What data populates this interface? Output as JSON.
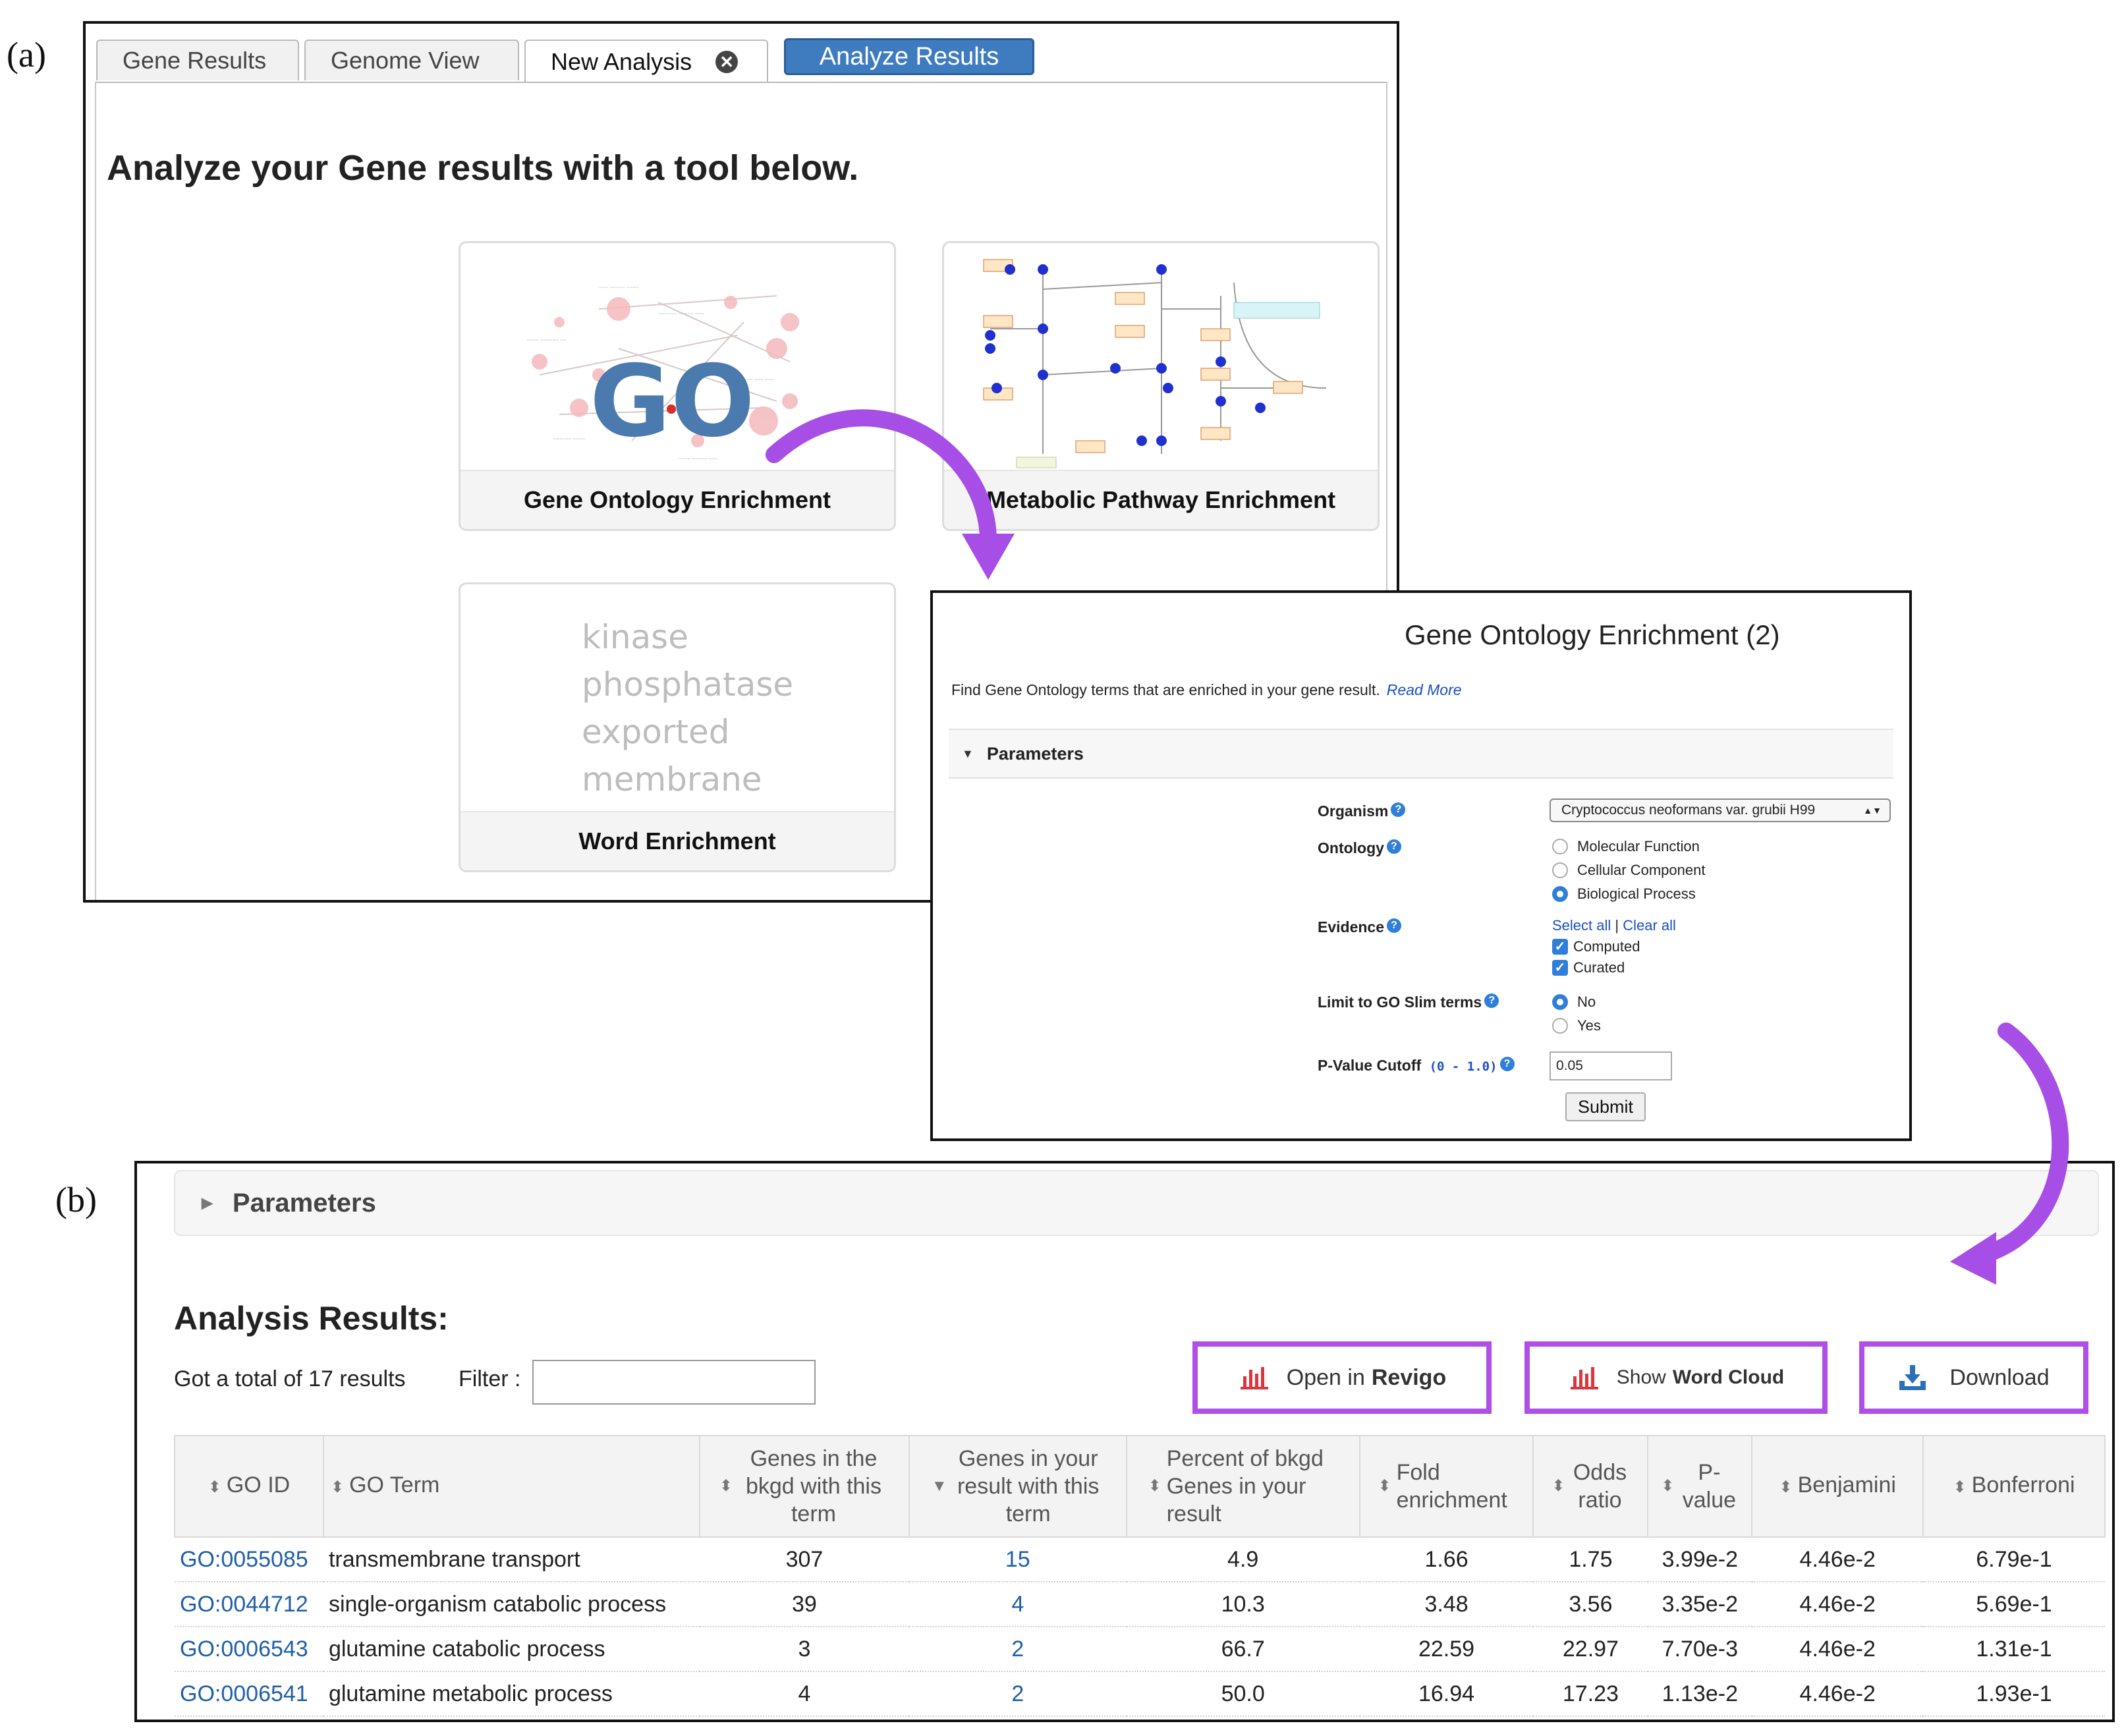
{
  "labels": {
    "a": "(a)",
    "b": "(b)"
  },
  "tabs": [
    {
      "label": "Gene Results",
      "active": false
    },
    {
      "label": "Genome View",
      "active": false
    },
    {
      "label": "New Analysis",
      "active": true
    }
  ],
  "analyze_button": "Analyze Results",
  "analysis_heading": "Analyze your Gene results with a tool below.",
  "tools": {
    "go": {
      "caption": "Gene Ontology Enrichment",
      "logo": "GO"
    },
    "pathway": {
      "caption": "Metabolic Pathway Enrichment"
    },
    "word": {
      "caption": "Word Enrichment",
      "words": [
        "kinase",
        "phosphatase",
        "exported",
        "membrane"
      ]
    }
  },
  "dialog": {
    "title": "Gene Ontology Enrichment (2)",
    "description": "Find Gene Ontology terms that are enriched in your gene result.",
    "read_more": "Read More",
    "parameters_label": "Parameters",
    "organism_label": "Organism",
    "organism_value": "Cryptococcus neoformans var. grubii H99",
    "ontology_label": "Ontology",
    "ontology_options": [
      "Molecular Function",
      "Cellular Component",
      "Biological Process"
    ],
    "ontology_selected": "Biological Process",
    "evidence_label": "Evidence",
    "select_all": "Select all",
    "clear_all": "Clear all",
    "evidence_options": [
      "Computed",
      "Curated"
    ],
    "slim_label": "Limit to GO Slim terms",
    "slim_options": [
      "No",
      "Yes"
    ],
    "slim_selected": "No",
    "pvalue_label": "P-Value Cutoff",
    "pvalue_range": "(0 - 1.0)",
    "pvalue_value": "0.05",
    "submit": "Submit"
  },
  "results": {
    "parameters_label": "Parameters",
    "heading": "Analysis Results:",
    "total": "Got a total of 17 results",
    "filter_label": "Filter :",
    "buttons": {
      "revigo_pre": "Open in",
      "revigo_bold": "Revigo",
      "wordcloud_pre": "Show",
      "wordcloud_bold": "Word Cloud",
      "download": "Download"
    },
    "columns": [
      "GO ID",
      "GO Term",
      "Genes in the bkgd with this term",
      "Genes in your result with this term",
      "Percent of bkgd Genes in your result",
      "Fold enrichment",
      "Odds ratio",
      "P-value",
      "Benjamini",
      "Bonferroni"
    ],
    "rows": [
      [
        "GO:0055085",
        "transmembrane transport",
        "307",
        "15",
        "4.9",
        "1.66",
        "1.75",
        "3.99e-2",
        "4.46e-2",
        "6.79e-1"
      ],
      [
        "GO:0044712",
        "single-organism catabolic process",
        "39",
        "4",
        "10.3",
        "3.48",
        "3.56",
        "3.35e-2",
        "4.46e-2",
        "5.69e-1"
      ],
      [
        "GO:0006543",
        "glutamine catabolic process",
        "3",
        "2",
        "66.7",
        "22.59",
        "22.97",
        "7.70e-3",
        "4.46e-2",
        "1.31e-1"
      ],
      [
        "GO:0006541",
        "glutamine metabolic process",
        "4",
        "2",
        "50.0",
        "16.94",
        "17.23",
        "1.13e-2",
        "4.46e-2",
        "1.93e-1"
      ]
    ]
  },
  "colors": {
    "accent": "#3e7cbf",
    "highlight": "#b04ee8",
    "link": "#1f5fa8",
    "icon_red": "#d9363e"
  }
}
